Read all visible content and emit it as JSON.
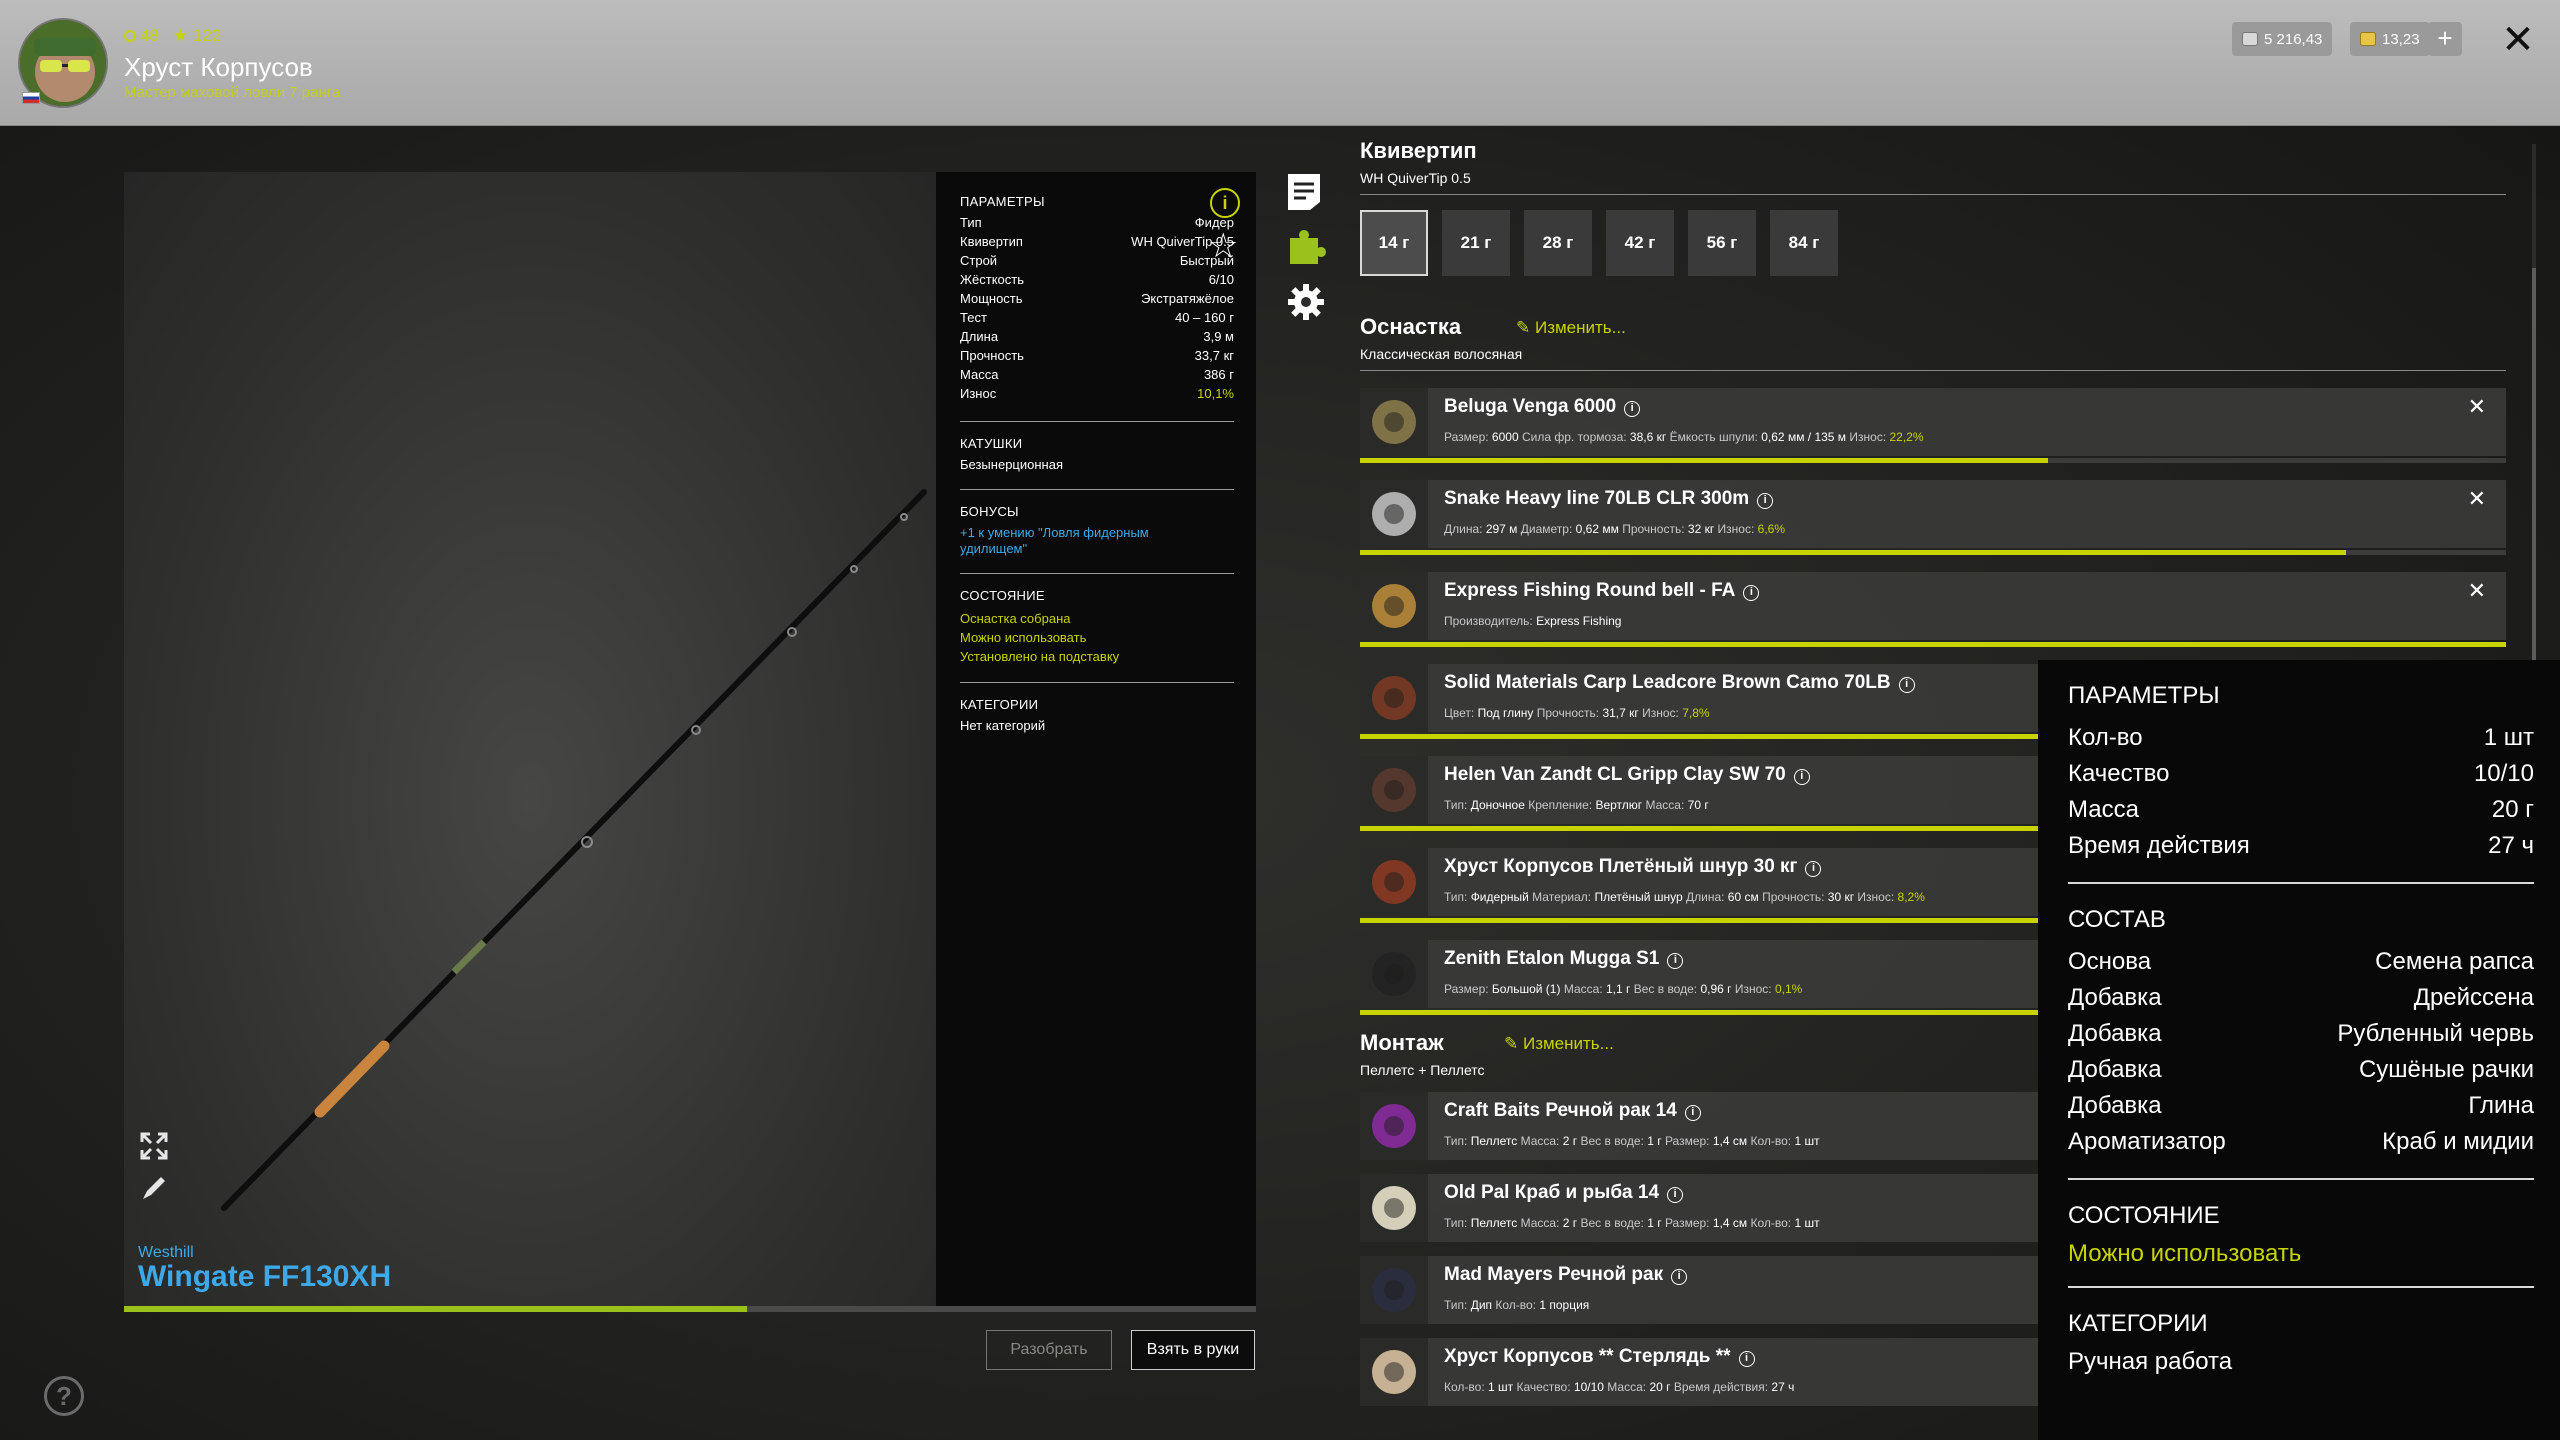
{
  "player": {
    "level": "48",
    "stars": "122",
    "name": "Хруст Корпусов",
    "rank": "Мастер маховой ловли 7 ранга"
  },
  "currency": {
    "silver": "5 216,43",
    "gold": "13,23",
    "add_label": "+"
  },
  "rod": {
    "brand": "Westhill",
    "model": "Wingate FF130XH",
    "progress_fraction": 0.55
  },
  "params_panel": {
    "params_title": "ПАРАМЕТРЫ",
    "params": [
      {
        "label": "Тип",
        "value": "Фидер"
      },
      {
        "label": "Квивертип",
        "value": "WH QuiverTip 0.5"
      },
      {
        "label": "Строй",
        "value": "Быстрый"
      },
      {
        "label": "Жёсткость",
        "value": "6/10"
      },
      {
        "label": "Мощность",
        "value": "Экстратяжёлое"
      },
      {
        "label": "Тест",
        "value": "40 – 160 г"
      },
      {
        "label": "Длина",
        "value": "3,9 м"
      },
      {
        "label": "Прочность",
        "value": "33,7 кг"
      },
      {
        "label": "Масса",
        "value": "386 г"
      },
      {
        "label": "Износ",
        "value": "10,1%"
      }
    ],
    "reels_title": "КАТУШКИ",
    "reels_value": "Безынерционная",
    "bonus_title": "БОНУСЫ",
    "bonus_value": "+1 к умению \"Ловля фидерным удилищем\"",
    "state_title": "СОСТОЯНИЕ",
    "state_values": [
      "Оснастка собрана",
      "Можно использовать",
      "Установлено на подставку"
    ],
    "categories_title": "КАТЕГОРИИ",
    "categories_value": "Нет категорий",
    "info_icon": "i",
    "star_icon": "☆"
  },
  "buttons": {
    "disassemble": "Разобрать",
    "take": "Взять в руки",
    "help": "?"
  },
  "quiver": {
    "title": "Квивертип",
    "subtitle": "WH QuiverTip 0.5",
    "options": [
      "14 г",
      "21 г",
      "28 г",
      "42 г",
      "56 г",
      "84 г"
    ],
    "selected_index": 0
  },
  "tackle": {
    "title": "Оснастка",
    "edit_label": "Изменить...",
    "subtitle": "Классическая волосяная",
    "items": [
      {
        "name": "Beluga Venga 6000",
        "meta": [
          [
            "Размер:",
            "6000"
          ],
          [
            "Сила фр. тормоза:",
            "38,6 кг"
          ],
          [
            "Ёмкость шпули:",
            "0,62 мм / 135 м"
          ],
          [
            "Износ:",
            "22,2%"
          ]
        ],
        "wear_fraction": 0.6,
        "removable": true
      },
      {
        "name": "Snake Heavy line 70LB CLR 300m",
        "meta": [
          [
            "Длина:",
            "297 м"
          ],
          [
            "Диаметр:",
            "0,62 мм"
          ],
          [
            "Прочность:",
            "32 кг"
          ],
          [
            "Износ:",
            "6,6%"
          ]
        ],
        "wear_fraction": 0.86,
        "removable": true
      },
      {
        "name": "Express Fishing Round bell - FA",
        "meta": [
          [
            "Производитель:",
            "Express Fishing"
          ]
        ],
        "wear_fraction": 1.0,
        "removable": true
      },
      {
        "name": "Solid Materials Carp Leadcore Brown Camo 70LB",
        "meta": [
          [
            "Цвет:",
            "Под глину"
          ],
          [
            "Прочность:",
            "31,7 кг"
          ],
          [
            "Износ:",
            "7,8%"
          ]
        ],
        "wear_fraction": 1.0,
        "removable": false
      },
      {
        "name": "Helen Van Zandt CL Gripp Clay SW 70",
        "meta": [
          [
            "Тип:",
            "Доночное"
          ],
          [
            "Крепление:",
            "Вертлюг"
          ],
          [
            "Масса:",
            "70 г"
          ]
        ],
        "wear_fraction": 1.0,
        "removable": false
      },
      {
        "name": "Хруст Корпусов Плетёный шнур 30 кг",
        "meta": [
          [
            "Тип:",
            "Фидерный"
          ],
          [
            "Материал:",
            "Плетёный шнур"
          ],
          [
            "Длина:",
            "60 см"
          ],
          [
            "Прочность:",
            "30 кг"
          ],
          [
            "Износ:",
            "8,2%"
          ]
        ],
        "wear_fraction": 1.0,
        "removable": false
      },
      {
        "name": "Zenith Etalon Mugga S1",
        "meta": [
          [
            "Размер:",
            "Большой (1)"
          ],
          [
            "Масса:",
            "1,1 г"
          ],
          [
            "Вес в воде:",
            "0,96 г"
          ],
          [
            "Износ:",
            "0,1%"
          ]
        ],
        "wear_fraction": 1.0,
        "removable": false
      }
    ]
  },
  "montage": {
    "title": "Монтаж",
    "edit_label": "Изменить...",
    "subtitle": "Пеллетс + Пеллетс",
    "items": [
      {
        "name": "Craft Baits Речной рак 14",
        "meta": [
          [
            "Тип:",
            "Пеллетс"
          ],
          [
            "Масса:",
            "2 г"
          ],
          [
            "Вес в воде:",
            "1 г"
          ],
          [
            "Размер:",
            "1,4 см"
          ],
          [
            "Кол-во:",
            "1 шт"
          ]
        ]
      },
      {
        "name": "Old Pal Краб и рыба 14",
        "meta": [
          [
            "Тип:",
            "Пеллетс"
          ],
          [
            "Масса:",
            "2 г"
          ],
          [
            "Вес в воде:",
            "1 г"
          ],
          [
            "Размер:",
            "1,4 см"
          ],
          [
            "Кол-во:",
            "1 шт"
          ]
        ]
      },
      {
        "name": "Mad Mayers Речной рак",
        "meta": [
          [
            "Тип:",
            "Дип"
          ],
          [
            "Кол-во:",
            "1 порция"
          ]
        ]
      },
      {
        "name": "Хруст Корпусов ** Стерлядь **",
        "meta": [
          [
            "Кол-во:",
            "1 шт"
          ],
          [
            "Качество:",
            "10/10"
          ],
          [
            "Масса:",
            "20 г"
          ],
          [
            "Время действия:",
            "27 ч"
          ]
        ]
      }
    ]
  },
  "tooltip": {
    "params_title": "ПАРАМЕТРЫ",
    "params": [
      {
        "label": "Кол-во",
        "value": "1 шт"
      },
      {
        "label": "Качество",
        "value": "10/10"
      },
      {
        "label": "Масса",
        "value": "20 г"
      },
      {
        "label": "Время действия",
        "value": "27 ч"
      }
    ],
    "composition_title": "СОСТАВ",
    "composition": [
      {
        "label": "Основа",
        "value": "Семена рапса"
      },
      {
        "label": "Добавка",
        "value": "Дрейссена"
      },
      {
        "label": "Добавка",
        "value": "Рубленный червь"
      },
      {
        "label": "Добавка",
        "value": "Сушёные рачки"
      },
      {
        "label": "Добавка",
        "value": "Глина"
      },
      {
        "label": "Ароматизатор",
        "value": "Краб и мидии"
      }
    ],
    "state_title": "СОСТОЯНИЕ",
    "state_value": "Можно использовать",
    "categories_title": "КАТЕГОРИИ",
    "categories_value": "Ручная работа"
  },
  "colors": {
    "accent_green": "#c7d400",
    "link_blue": "#3ea9e8",
    "wear_bar": "#c7d400"
  }
}
